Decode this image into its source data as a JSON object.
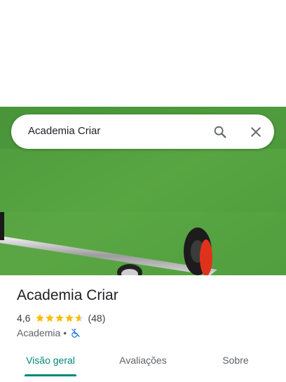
{
  "search": {
    "query": "Academia Criar"
  },
  "place": {
    "name": "Academia Criar",
    "rating": "4,6",
    "stars_filled": 4.6,
    "review_count": "(48)",
    "category": "Academia",
    "separator": "•",
    "accessibility_icon": "wheelchair-not-accessible-icon"
  },
  "tabs": [
    {
      "label": "Visão geral",
      "active": true
    },
    {
      "label": "Avaliações",
      "active": false
    },
    {
      "label": "Sobre",
      "active": false
    }
  ],
  "colors": {
    "accent": "#01877b",
    "star": "#fbbc04",
    "turf": "#4a9a3a",
    "plate_red": "#e0311c",
    "a11y_blue": "#1a73e8"
  }
}
